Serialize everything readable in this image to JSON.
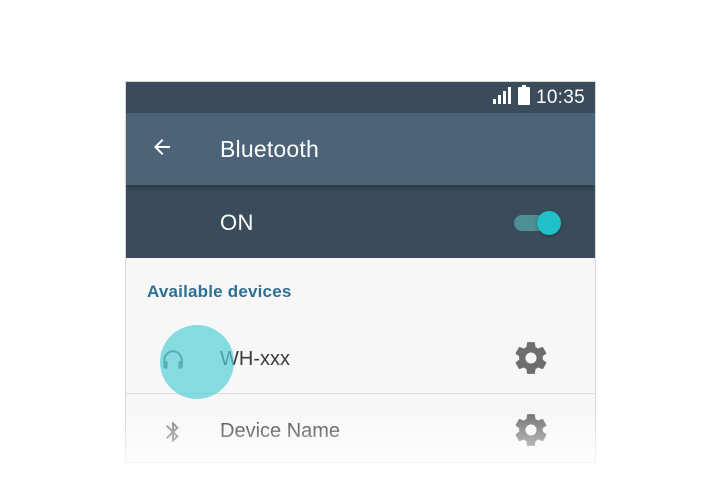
{
  "status_bar": {
    "time": "10:35",
    "icons": [
      "signal-icon",
      "battery-icon"
    ]
  },
  "toolbar": {
    "back_icon": "arrow-back-icon",
    "title": "Bluetooth"
  },
  "master_switch": {
    "label": "ON",
    "checked": true
  },
  "available_devices": {
    "header": "Available devices",
    "items": [
      {
        "name": "WH-xxx",
        "icon": "headphones-icon",
        "settings_icon": "gear-icon"
      },
      {
        "name": "Device Name",
        "icon": "bluetooth-icon",
        "settings_icon": "gear-icon"
      }
    ]
  },
  "colors": {
    "status_bar": "#3a4c5c",
    "toolbar": "#4d6478",
    "switch_row": "#3a4c5c",
    "accent": "#1fc0c8",
    "section_header": "#2e6f96",
    "ripple": "#4dced6"
  }
}
